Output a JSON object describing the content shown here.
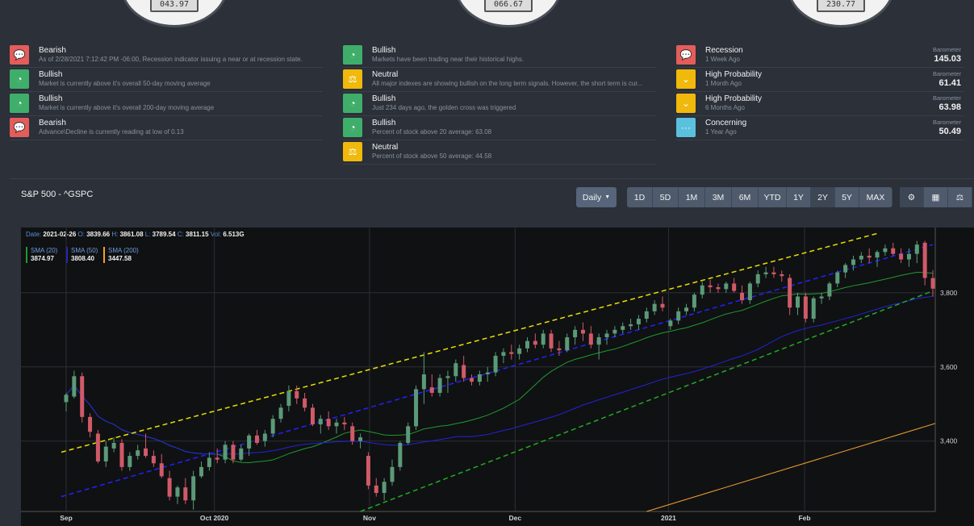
{
  "gauges": [
    {
      "value": "043.97"
    },
    {
      "value": "066.67"
    },
    {
      "value": "230.77"
    }
  ],
  "indicators": {
    "col1": [
      {
        "title": "Bearish",
        "desc": "As of 2/28/2021 7:12:42 PM -06:00, Recession indicator issuing a near or at recession state.",
        "color": "red",
        "icon": "chat-icon"
      },
      {
        "title": "Bullish",
        "desc": "Market is currently above it's overall 50-day moving average",
        "color": "green",
        "icon": "gauge-icon"
      },
      {
        "title": "Bullish",
        "desc": "Market is currently above it's overall 200-day moving average",
        "color": "green",
        "icon": "gauge-icon"
      },
      {
        "title": "Bearish",
        "desc": "Advance\\Decline is currently reading at low of 0.13",
        "color": "red",
        "icon": "chat-icon"
      }
    ],
    "col2": [
      {
        "title": "Bullish",
        "desc": "Markets have been trading near their historical highs.",
        "color": "green",
        "icon": "gauge-icon"
      },
      {
        "title": "Neutral",
        "desc": "All major indexes are showing bullish on the long term signals. However, the short term is cur...",
        "color": "yellow",
        "icon": "scale-icon"
      },
      {
        "title": "Bullish",
        "desc": "Just 234 days ago, the golden cross was triggered",
        "color": "green",
        "icon": "gauge-icon"
      },
      {
        "title": "Bullish",
        "desc": "Percent of stock above 20 average: 63.08",
        "color": "green",
        "icon": "gauge-icon"
      },
      {
        "title": "Neutral",
        "desc": "Percent of stock above 50 average: 44.58",
        "color": "yellow",
        "icon": "scale-icon"
      }
    ],
    "col3": [
      {
        "title": "Recession",
        "desc": "1 Week Ago",
        "color": "red",
        "icon": "chat-icon",
        "label": "Barometer",
        "value": "145.03"
      },
      {
        "title": "High Probability",
        "desc": "1 Month Ago",
        "color": "yellow",
        "icon": "chevron-down-icon",
        "label": "Barometer",
        "value": "61.41"
      },
      {
        "title": "High Probability",
        "desc": "6 Months Ago",
        "color": "yellow",
        "icon": "chevron-down-icon",
        "label": "Barometer",
        "value": "63.98"
      },
      {
        "title": "Concerning",
        "desc": "1 Year Ago",
        "color": "cyan",
        "icon": "dots-icon",
        "label": "Barometer",
        "value": "50.49"
      }
    ]
  },
  "panel": {
    "title": "S&P 500 - ^GSPC",
    "interval": "Daily",
    "ranges": [
      "1D",
      "5D",
      "1M",
      "3M",
      "6M",
      "YTD",
      "1Y",
      "2Y",
      "5Y",
      "MAX"
    ],
    "active_range": "2Y",
    "tools": [
      {
        "icon": "gears-icon"
      },
      {
        "icon": "calculator-icon"
      },
      {
        "icon": "balance-scale-icon"
      }
    ]
  },
  "ohlc": {
    "date_label": "Date:",
    "date": "2021-02-26",
    "o_label": "O:",
    "o": "3839.66",
    "h_label": "H:",
    "h": "3861.08",
    "l_label": "L:",
    "l": "3789.54",
    "c_label": "C:",
    "c": "3811.15",
    "vol_label": "Vol:",
    "vol": "6.513G"
  },
  "sma": [
    {
      "name": "SMA (20)",
      "value": "3874.97",
      "color": "#1f9a2e"
    },
    {
      "name": "SMA (50)",
      "value": "3808.40",
      "color": "#2323d8"
    },
    {
      "name": "SMA (200)",
      "value": "3447.58",
      "color": "#f0a030"
    }
  ],
  "chart_data": {
    "type": "candlestick",
    "x_labels": [
      "Sep",
      "Oct 2020",
      "Nov",
      "Dec",
      "2021",
      "Feb"
    ],
    "y_ticks": [
      3400,
      3600,
      3800
    ],
    "y_tick_labels": [
      "3,400",
      "3,600",
      "3,800"
    ],
    "ylim": [
      3210,
      3950
    ],
    "grid": true,
    "colors": {
      "up": "#5b9a78",
      "down": "#d05a68",
      "sma20": "#1f9a2e",
      "sma50": "#2323d8",
      "sma200": "#f0a030",
      "trend_upper": "#e8e000",
      "trend_mid": "#2222ff",
      "trend_lower": "#22aa22"
    },
    "candles": [
      [
        3505,
        3530,
        3480,
        3525
      ],
      [
        3520,
        3590,
        3515,
        3575
      ],
      [
        3575,
        3585,
        3450,
        3465
      ],
      [
        3465,
        3475,
        3410,
        3425
      ],
      [
        3420,
        3430,
        3340,
        3345
      ],
      [
        3345,
        3400,
        3330,
        3385
      ],
      [
        3380,
        3410,
        3370,
        3395
      ],
      [
        3395,
        3405,
        3320,
        3330
      ],
      [
        3330,
        3370,
        3320,
        3360
      ],
      [
        3360,
        3390,
        3350,
        3375
      ],
      [
        3380,
        3420,
        3355,
        3360
      ],
      [
        3360,
        3375,
        3330,
        3340
      ],
      [
        3340,
        3365,
        3300,
        3305
      ],
      [
        3300,
        3320,
        3240,
        3250
      ],
      [
        3250,
        3280,
        3230,
        3275
      ],
      [
        3275,
        3300,
        3230,
        3240
      ],
      [
        3240,
        3320,
        3215,
        3305
      ],
      [
        3305,
        3345,
        3300,
        3330
      ],
      [
        3330,
        3370,
        3320,
        3355
      ],
      [
        3355,
        3380,
        3340,
        3350
      ],
      [
        3350,
        3400,
        3340,
        3390
      ],
      [
        3390,
        3400,
        3340,
        3350
      ],
      [
        3350,
        3390,
        3345,
        3380
      ],
      [
        3380,
        3420,
        3360,
        3415
      ],
      [
        3415,
        3430,
        3390,
        3395
      ],
      [
        3400,
        3430,
        3385,
        3420
      ],
      [
        3420,
        3470,
        3410,
        3460
      ],
      [
        3460,
        3500,
        3450,
        3490
      ],
      [
        3495,
        3550,
        3480,
        3535
      ],
      [
        3535,
        3550,
        3500,
        3515
      ],
      [
        3515,
        3530,
        3480,
        3490
      ],
      [
        3490,
        3500,
        3440,
        3445
      ],
      [
        3445,
        3470,
        3420,
        3460
      ],
      [
        3460,
        3480,
        3430,
        3440
      ],
      [
        3440,
        3460,
        3420,
        3450
      ],
      [
        3450,
        3465,
        3430,
        3445
      ],
      [
        3440,
        3450,
        3390,
        3400
      ],
      [
        3400,
        3420,
        3380,
        3410
      ],
      [
        3360,
        3370,
        3270,
        3280
      ],
      [
        3280,
        3300,
        3250,
        3260
      ],
      [
        3260,
        3300,
        3240,
        3290
      ],
      [
        3290,
        3350,
        3280,
        3330
      ],
      [
        3330,
        3400,
        3320,
        3395
      ],
      [
        3395,
        3450,
        3390,
        3440
      ],
      [
        3440,
        3550,
        3430,
        3540
      ],
      [
        3540,
        3640,
        3500,
        3580
      ],
      [
        3545,
        3580,
        3520,
        3530
      ],
      [
        3530,
        3580,
        3520,
        3570
      ],
      [
        3570,
        3590,
        3530,
        3575
      ],
      [
        3575,
        3620,
        3560,
        3610
      ],
      [
        3605,
        3630,
        3560,
        3570
      ],
      [
        3570,
        3580,
        3550,
        3560
      ],
      [
        3560,
        3590,
        3550,
        3580
      ],
      [
        3580,
        3600,
        3560,
        3585
      ],
      [
        3585,
        3640,
        3575,
        3630
      ],
      [
        3630,
        3650,
        3610,
        3640
      ],
      [
        3640,
        3660,
        3620,
        3635
      ],
      [
        3635,
        3660,
        3620,
        3650
      ],
      [
        3650,
        3680,
        3640,
        3670
      ],
      [
        3670,
        3690,
        3650,
        3660
      ],
      [
        3660,
        3700,
        3650,
        3690
      ],
      [
        3690,
        3700,
        3640,
        3650
      ],
      [
        3650,
        3670,
        3630,
        3645
      ],
      [
        3645,
        3690,
        3640,
        3680
      ],
      [
        3680,
        3710,
        3660,
        3700
      ],
      [
        3700,
        3720,
        3670,
        3690
      ],
      [
        3690,
        3710,
        3650,
        3660
      ],
      [
        3660,
        3690,
        3620,
        3680
      ],
      [
        3680,
        3700,
        3660,
        3690
      ],
      [
        3690,
        3710,
        3680,
        3700
      ],
      [
        3700,
        3720,
        3690,
        3710
      ],
      [
        3710,
        3730,
        3700,
        3715
      ],
      [
        3715,
        3740,
        3700,
        3730
      ],
      [
        3730,
        3760,
        3720,
        3750
      ],
      [
        3750,
        3780,
        3740,
        3770
      ],
      [
        3770,
        3790,
        3750,
        3760
      ],
      [
        3710,
        3730,
        3700,
        3725
      ],
      [
        3725,
        3760,
        3715,
        3750
      ],
      [
        3750,
        3770,
        3740,
        3760
      ],
      [
        3760,
        3800,
        3750,
        3795
      ],
      [
        3795,
        3830,
        3785,
        3820
      ],
      [
        3820,
        3835,
        3800,
        3815
      ],
      [
        3815,
        3825,
        3800,
        3810
      ],
      [
        3810,
        3830,
        3800,
        3825
      ],
      [
        3825,
        3840,
        3800,
        3805
      ],
      [
        3800,
        3820,
        3770,
        3780
      ],
      [
        3780,
        3830,
        3770,
        3825
      ],
      [
        3825,
        3860,
        3815,
        3850
      ],
      [
        3850,
        3870,
        3840,
        3855
      ],
      [
        3855,
        3870,
        3840,
        3850
      ],
      [
        3850,
        3860,
        3830,
        3845
      ],
      [
        3840,
        3850,
        3740,
        3760
      ],
      [
        3760,
        3800,
        3740,
        3790
      ],
      [
        3790,
        3800,
        3720,
        3730
      ],
      [
        3730,
        3790,
        3720,
        3785
      ],
      [
        3785,
        3800,
        3770,
        3790
      ],
      [
        3790,
        3830,
        3780,
        3825
      ],
      [
        3825,
        3860,
        3815,
        3855
      ],
      [
        3855,
        3880,
        3840,
        3875
      ],
      [
        3875,
        3900,
        3860,
        3890
      ],
      [
        3890,
        3910,
        3880,
        3900
      ],
      [
        3900,
        3920,
        3880,
        3895
      ],
      [
        3895,
        3915,
        3870,
        3910
      ],
      [
        3910,
        3930,
        3900,
        3920
      ],
      [
        3920,
        3935,
        3900,
        3905
      ],
      [
        3905,
        3920,
        3880,
        3890
      ],
      [
        3890,
        3920,
        3870,
        3905
      ],
      [
        3905,
        3940,
        3880,
        3930
      ],
      [
        3935,
        3940,
        3820,
        3840
      ],
      [
        3839.66,
        3861.08,
        3789.54,
        3811.15
      ]
    ]
  }
}
